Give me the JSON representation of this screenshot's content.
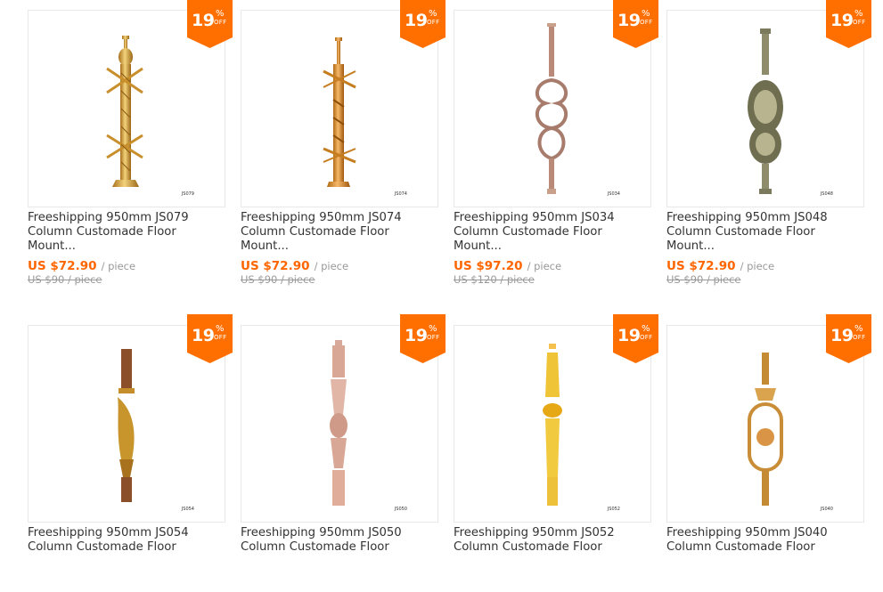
{
  "colors": {
    "badge": "#ff6f00",
    "price": "#ff6600",
    "muted": "#999999",
    "text": "#333333"
  },
  "products": [
    {
      "title": "Freeshipping 950mm JS079 Column Customade Floor Mount...",
      "code": "JS079",
      "price": "US $72.90",
      "unit": "/ piece",
      "original": "US $90 / piece",
      "discount": "19",
      "pct": "%",
      "off": "OFF",
      "image": "gold-spiral-baluster"
    },
    {
      "title": "Freeshipping 950mm JS074 Column Customade Floor Mount...",
      "code": "JS074",
      "price": "US $72.90",
      "unit": "/ piece",
      "original": "US $90 / piece",
      "discount": "19",
      "pct": "%",
      "off": "OFF",
      "image": "gold-twisted-baluster"
    },
    {
      "title": "Freeshipping 950mm JS034 Column Customade Floor Mount...",
      "code": "JS034",
      "price": "US $97.20",
      "unit": "/ piece",
      "original": "US $120 / piece",
      "discount": "19",
      "pct": "%",
      "off": "OFF",
      "image": "rose-scroll-baluster"
    },
    {
      "title": "Freeshipping 950mm JS048 Column Customade Floor Mount...",
      "code": "JS048",
      "price": "US $72.90",
      "unit": "/ piece",
      "original": "US $90 / piece",
      "discount": "19",
      "pct": "%",
      "off": "OFF",
      "image": "bronze-oval-baluster"
    },
    {
      "title": "Freeshipping 950mm JS054 Column Customade Floor",
      "code": "JS054",
      "image": "wood-carved-baluster",
      "discount": "19",
      "pct": "%",
      "off": "OFF"
    },
    {
      "title": "Freeshipping 950mm JS050 Column Customade Floor",
      "code": "JS050",
      "image": "rose-square-baluster",
      "discount": "19",
      "pct": "%",
      "off": "OFF"
    },
    {
      "title": "Freeshipping 950mm JS052 Column Customade Floor",
      "code": "JS052",
      "image": "yellow-gold-baluster",
      "discount": "19",
      "pct": "%",
      "off": "OFF"
    },
    {
      "title": "Freeshipping 950mm JS040 Column Customade Floor",
      "code": "JS040",
      "image": "gold-ornament-baluster",
      "discount": "19",
      "pct": "%",
      "off": "OFF"
    }
  ]
}
